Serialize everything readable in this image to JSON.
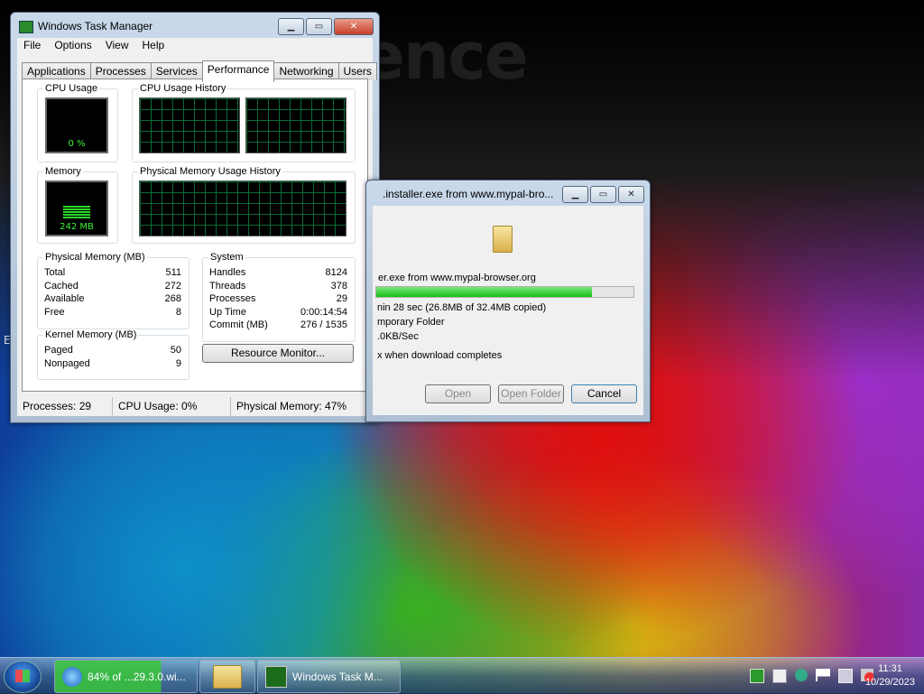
{
  "desktop": {
    "wallpaper_word": "ence",
    "side_letter": "E"
  },
  "task_manager": {
    "title": "Windows Task Manager",
    "menu": [
      "File",
      "Options",
      "View",
      "Help"
    ],
    "tabs": [
      "Applications",
      "Processes",
      "Services",
      "Performance",
      "Networking",
      "Users"
    ],
    "active_tab": "Performance",
    "groups": {
      "cpu_usage": "CPU Usage",
      "cpu_history": "CPU Usage History",
      "memory": "Memory",
      "mem_history": "Physical Memory Usage History",
      "physical_memory": "Physical Memory (MB)",
      "system": "System",
      "kernel_memory": "Kernel Memory (MB)"
    },
    "cpu_value": "0 %",
    "memory_value": "242 MB",
    "physical_memory_rows": [
      {
        "label": "Total",
        "value": "511"
      },
      {
        "label": "Cached",
        "value": "272"
      },
      {
        "label": "Available",
        "value": "268"
      },
      {
        "label": "Free",
        "value": "8"
      }
    ],
    "system_rows": [
      {
        "label": "Handles",
        "value": "8124"
      },
      {
        "label": "Threads",
        "value": "378"
      },
      {
        "label": "Processes",
        "value": "29"
      },
      {
        "label": "Up Time",
        "value": "0:00:14:54"
      },
      {
        "label": "Commit (MB)",
        "value": "276 / 1535"
      }
    ],
    "kernel_rows": [
      {
        "label": "Paged",
        "value": "50"
      },
      {
        "label": "Nonpaged",
        "value": "9"
      }
    ],
    "resource_monitor_button": "Resource Monitor...",
    "status": {
      "processes": "Processes: 29",
      "cpu": "CPU Usage: 0%",
      "memory": "Physical Memory: 47%"
    }
  },
  "download": {
    "title": ".installer.exe from www.mypal-bro...",
    "filename_line": "er.exe from www.mypal-browser.org",
    "progress_percent": 84,
    "time_line": "nin 28 sec (26.8MB of 32.4MB copied)",
    "folder_line": "mporary Folder",
    "speed_line": ".0KB/Sec",
    "close_line": "x when download completes",
    "buttons": {
      "open": "Open",
      "open_folder": "Open Folder",
      "cancel": "Cancel"
    }
  },
  "taskbar": {
    "items": [
      {
        "label": "84% of ...29.3.0.wi..."
      },
      {
        "label": ""
      },
      {
        "label": "Windows Task M..."
      }
    ],
    "clock_time": "11:31",
    "clock_date": "10/29/2023"
  }
}
